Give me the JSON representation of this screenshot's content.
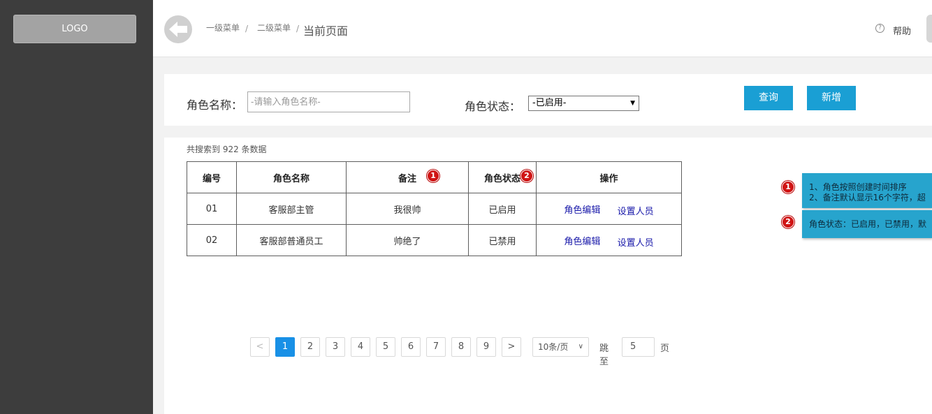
{
  "sidebar": {
    "logo_text": "LOGO"
  },
  "header": {
    "breadcrumbs": [
      "一级菜单",
      "二级菜单",
      "当前页面"
    ],
    "separator": "/",
    "help_label": "帮助"
  },
  "search": {
    "role_name_label": "角色名称：",
    "role_name_placeholder": "-请输入角色名称-",
    "role_status_label": "角色状态：",
    "role_status_value": "-已启用-",
    "query_button": "查询",
    "add_button": "新增"
  },
  "results": {
    "count_text": "共搜索到 922 条数据",
    "columns": [
      "编号",
      "角色名称",
      "备注",
      "角色状态",
      "操作"
    ],
    "rows": [
      {
        "id": "01",
        "name": "客服部主管",
        "remark": "我很帅",
        "status": "已启用",
        "edit": "角色编辑",
        "assign": "设置人员"
      },
      {
        "id": "02",
        "name": "客服部普通员工",
        "remark": "帅绝了",
        "status": "已禁用",
        "edit": "角色编辑",
        "assign": "设置人员"
      }
    ]
  },
  "pagination": {
    "prev": "<",
    "pages": [
      "1",
      "2",
      "3",
      "4",
      "5",
      "6",
      "7",
      "8",
      "9"
    ],
    "current_page": "1",
    "next": ">",
    "page_size": "10条/页",
    "jump_label": "跳至",
    "jump_value": "5",
    "page_suffix": "页"
  },
  "annotations": {
    "badge_1": "1",
    "badge_2": "2",
    "note_1_line_1": "1、角色按照创建时间排序",
    "note_1_line_2": "2、备注默认显示16个字符，超",
    "note_2_text": "角色状态：已启用，已禁用，默"
  },
  "colors": {
    "sidebar": "#3d3d3d",
    "primary_button": "#1a9fd4",
    "active_page": "#1890e6",
    "note_bg": "#27a4cd",
    "badge": "#d01414"
  }
}
